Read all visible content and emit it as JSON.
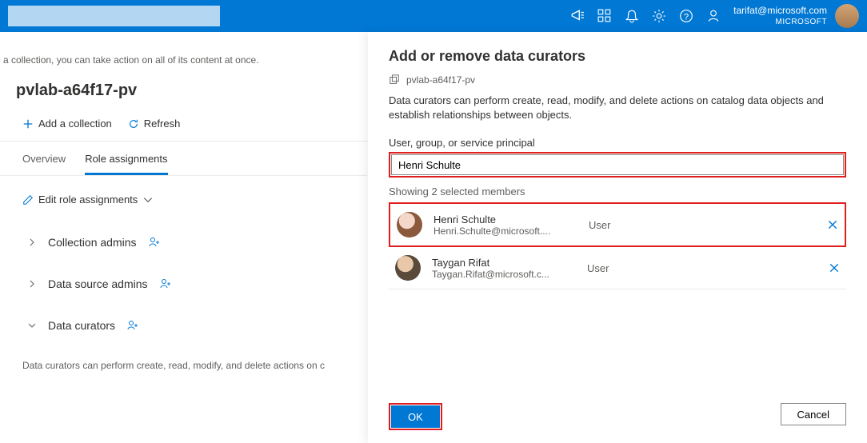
{
  "topbar": {
    "account_email": "tarifat@microsoft.com",
    "account_org": "MICROSOFT"
  },
  "left": {
    "crumb_note": "a collection, you can take action on all of its content at once.",
    "page_title": "pvlab-a64f17-pv",
    "toolbar": {
      "add_collection": "Add a collection",
      "refresh": "Refresh"
    },
    "tabs": {
      "overview": "Overview",
      "role_assignments": "Role assignments"
    },
    "edit_link": "Edit role assignments",
    "roles": [
      {
        "label": "Collection admins"
      },
      {
        "label": "Data source admins"
      },
      {
        "label": "Data curators"
      }
    ],
    "role_desc": "Data curators can perform create, read, modify, and delete actions on c"
  },
  "flyout": {
    "title": "Add or remove data curators",
    "scope": "pvlab-a64f17-pv",
    "desc": "Data curators can perform create, read, modify, and delete actions on catalog data objects and establish relationships between objects.",
    "field_label": "User, group, or service principal",
    "search_value": "Henri Schulte",
    "showing": "Showing 2 selected members",
    "members": [
      {
        "name": "Henri Schulte",
        "email": "Henri.Schulte@microsoft....",
        "type": "User"
      },
      {
        "name": "Taygan Rifat",
        "email": "Taygan.Rifat@microsoft.c...",
        "type": "User"
      }
    ],
    "ok": "OK",
    "cancel": "Cancel"
  }
}
